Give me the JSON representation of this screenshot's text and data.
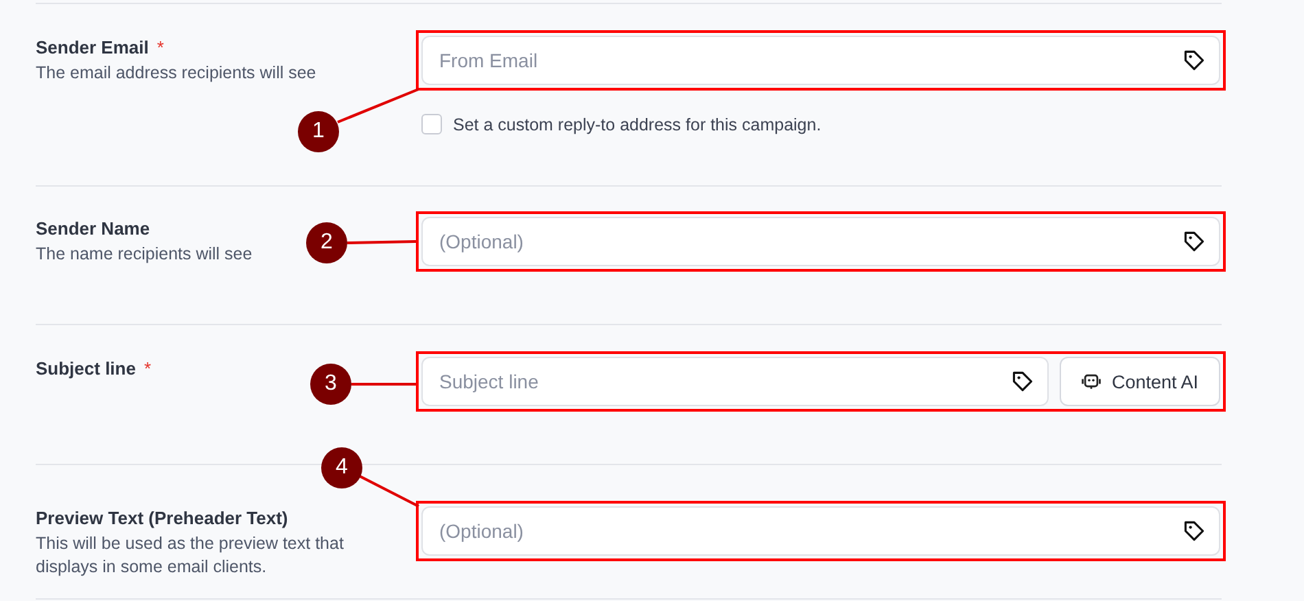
{
  "fields": [
    {
      "kind": "text",
      "label": "Sender Email",
      "required_mark": "*",
      "description": "The email address recipients will see",
      "placeholder": "From Email",
      "annotation": "1",
      "checkbox": {
        "label": "Set a custom reply-to address for this campaign.",
        "checked": false
      }
    },
    {
      "kind": "text",
      "label": "Sender Name",
      "description": "The name recipients will see",
      "placeholder": "(Optional)",
      "annotation": "2"
    },
    {
      "kind": "text_with_button",
      "label": "Subject line",
      "required_mark": "*",
      "placeholder": "Subject line",
      "annotation": "3",
      "button": "Content AI"
    },
    {
      "kind": "text",
      "label": "Preview Text (Preheader Text)",
      "description": "This will be used as the preview text that displays in some email clients.",
      "placeholder": "(Optional)",
      "annotation": "4"
    }
  ]
}
